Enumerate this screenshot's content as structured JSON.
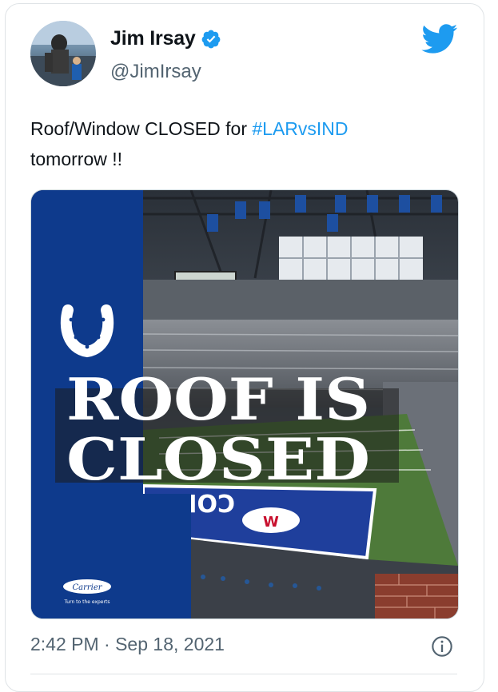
{
  "tweet": {
    "author_name": "Jim Irsay",
    "handle": "@JimIrsay",
    "text_main": "Roof/Window CLOSED for ",
    "hashtag": "#LARvsIND",
    "text_tail": "tomorrow !!",
    "timestamp": "2:42 PM · Sep 18, 2021"
  },
  "media": {
    "headline_line1": "ROOF IS",
    "headline_line2": "CLOSED",
    "sponsor_logo": "Carrier",
    "sponsor_tagline": "Turn to the experts",
    "field_text": "COL"
  },
  "icons": {
    "verified": "verified-badge-icon",
    "brand": "twitter-bird-icon",
    "info": "info-icon",
    "team_logo": "horseshoe-logo"
  },
  "colors": {
    "accent": "#1d9bf0",
    "colts_blue": "#0e3a8c",
    "text": "#0f1419",
    "secondary_text": "#536471"
  }
}
